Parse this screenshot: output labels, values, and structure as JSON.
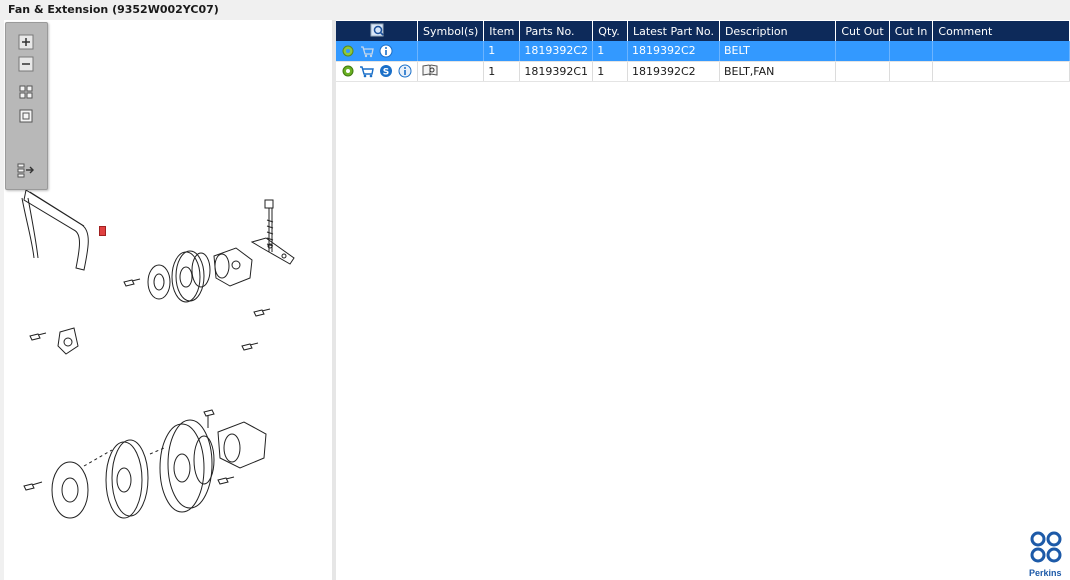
{
  "window": {
    "title": "Fan & Extension (9352W002YC07)"
  },
  "viewer": {
    "toolbar": {
      "zoom_in": "zoom-in",
      "zoom_out": "zoom-out",
      "fit": "fit-to-window",
      "actual_size": "actual-size",
      "export": "expand-list"
    },
    "callout_label": "1"
  },
  "grid": {
    "columns": [
      "",
      "Symbol(s)",
      "Item",
      "Parts No.",
      "Qty.",
      "Latest Part No.",
      "Description",
      "Cut Out",
      "Cut In",
      "Comment"
    ],
    "rows": [
      {
        "selected": true,
        "symbols": "",
        "item": "1",
        "parts_no": "1819392C2",
        "qty": "1",
        "latest_part_no": "1819392C2",
        "description": "BELT",
        "cut_out": "",
        "cut_in": "",
        "comment": "",
        "icons": [
          "gear-icon",
          "cart-icon",
          "info-icon"
        ]
      },
      {
        "selected": false,
        "symbols": "",
        "item": "1",
        "parts_no": "1819392C1",
        "qty": "1",
        "latest_part_no": "1819392C2",
        "description": "BELT,FAN",
        "cut_out": "",
        "cut_in": "",
        "comment": "",
        "icons": [
          "gear-icon",
          "cart-icon",
          "supersession-icon",
          "info-icon"
        ]
      }
    ]
  },
  "brand": {
    "name": "Perkins",
    "color": "#1d5aa8"
  },
  "colors": {
    "header_bg": "#0d2a5a",
    "selected_row": "#3399ff"
  }
}
